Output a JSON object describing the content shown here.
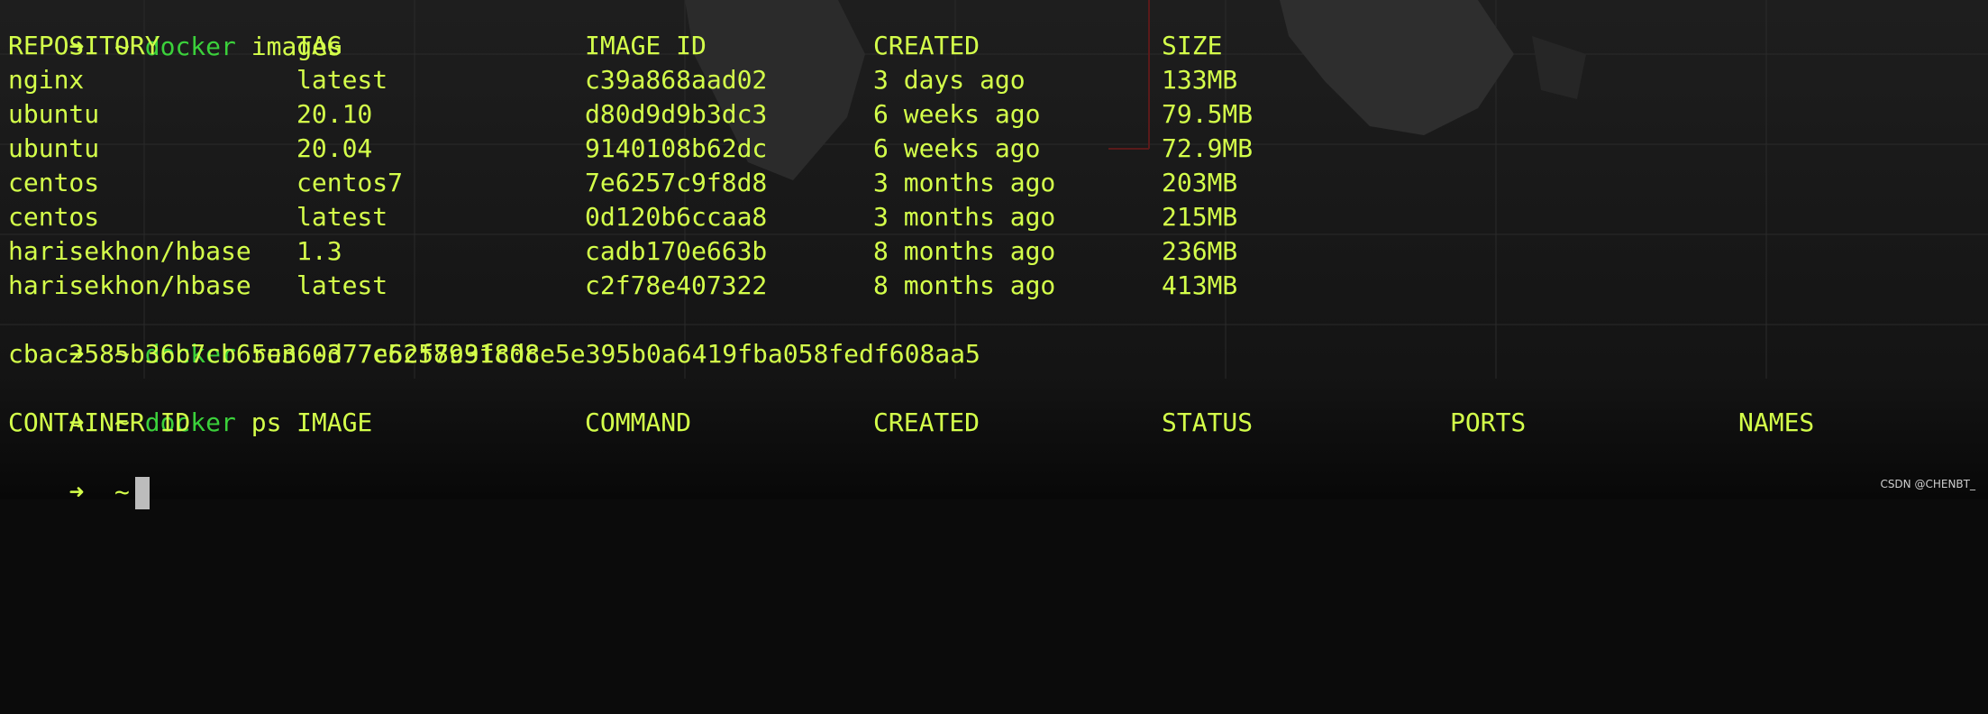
{
  "commands": {
    "images": {
      "prompt_arrow": "➜",
      "prompt_dir": "~",
      "name": "docker",
      "args": "images"
    },
    "run": {
      "prompt_arrow": "➜",
      "prompt_dir": "~",
      "name": "docker",
      "args": "run -d 7e6257c9f8d8"
    },
    "ps": {
      "prompt_arrow": "➜",
      "prompt_dir": "~",
      "name": "docker",
      "args": "ps"
    },
    "current": {
      "prompt_arrow": "➜",
      "prompt_dir": "~"
    }
  },
  "images_table": {
    "headers": [
      "REPOSITORY",
      "TAG",
      "IMAGE ID",
      "CREATED",
      "SIZE"
    ],
    "rows": [
      [
        "nginx",
        "latest",
        "c39a868aad02",
        "3 days ago",
        "133MB"
      ],
      [
        "ubuntu",
        "20.10",
        "d80d9d9b3dc3",
        "6 weeks ago",
        "79.5MB"
      ],
      [
        "ubuntu",
        "20.04",
        "9140108b62dc",
        "6 weeks ago",
        "72.9MB"
      ],
      [
        "centos",
        "centos7",
        "7e6257c9f8d8",
        "3 months ago",
        "203MB"
      ],
      [
        "centos",
        "latest",
        "0d120b6ccaa8",
        "3 months ago",
        "215MB"
      ],
      [
        "harisekhon/hbase",
        "1.3",
        "cadb170e663b",
        "8 months ago",
        "236MB"
      ],
      [
        "harisekhon/hbase",
        "latest",
        "c2f78e407322",
        "8 months ago",
        "413MB"
      ]
    ]
  },
  "run_output": "cbac2585b36b7cb65e360377c5cf8931c0ce5e395b0a6419fba058fedf608aa5",
  "ps_table": {
    "headers": [
      "CONTAINER ID",
      "IMAGE",
      "COMMAND",
      "CREATED",
      "STATUS",
      "PORTS",
      "NAMES"
    ]
  },
  "watermark": "CSDN @CHENBT_",
  "colors": {
    "text": "#d4ff4a",
    "command": "#3bd13b",
    "background": "#0b0b0b",
    "cursor": "#bcbcbc"
  }
}
